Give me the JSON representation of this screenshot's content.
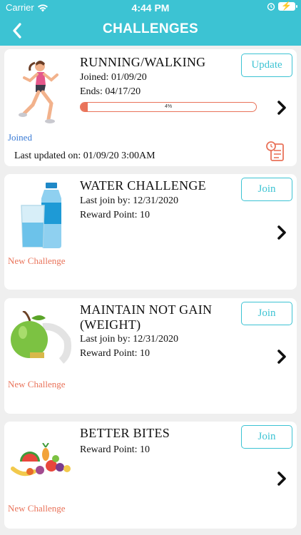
{
  "status_bar": {
    "carrier": "Carrier",
    "time": "4:44 PM"
  },
  "nav": {
    "title": "CHALLENGES"
  },
  "colors": {
    "header": "#3cc3d3",
    "accent": "#3cc3d3",
    "progress": "#e9735a",
    "joined": "#3a7bd5",
    "new": "#e9735a"
  },
  "challenges": [
    {
      "title": "RUNNING/WALKING",
      "lines": [
        "Joined: 01/09/20",
        "Ends: 04/17/20"
      ],
      "button": "Update",
      "progress": 4,
      "progress_label": "4%",
      "status": "Joined",
      "last_updated": "Last updated on: 01/09/20 3:00AM",
      "icon": "runner-icon"
    },
    {
      "title": "WATER CHALLENGE",
      "lines": [
        "Last join by: 12/31/2020",
        "Reward Point: 10"
      ],
      "button": "Join",
      "status": "New Challenge",
      "icon": "water-bottle-icon"
    },
    {
      "title_lines": [
        "MAINTAIN NOT GAIN",
        "(WEIGHT)"
      ],
      "lines": [
        "Last join by: 12/31/2020",
        "Reward Point: 10"
      ],
      "button": "Join",
      "status": "New Challenge",
      "icon": "apple-tape-icon"
    },
    {
      "title": "BETTER BITES",
      "lines": [
        "Reward Point: 10"
      ],
      "button": "Join",
      "status": "New Challenge",
      "icon": "fruits-icon"
    }
  ]
}
